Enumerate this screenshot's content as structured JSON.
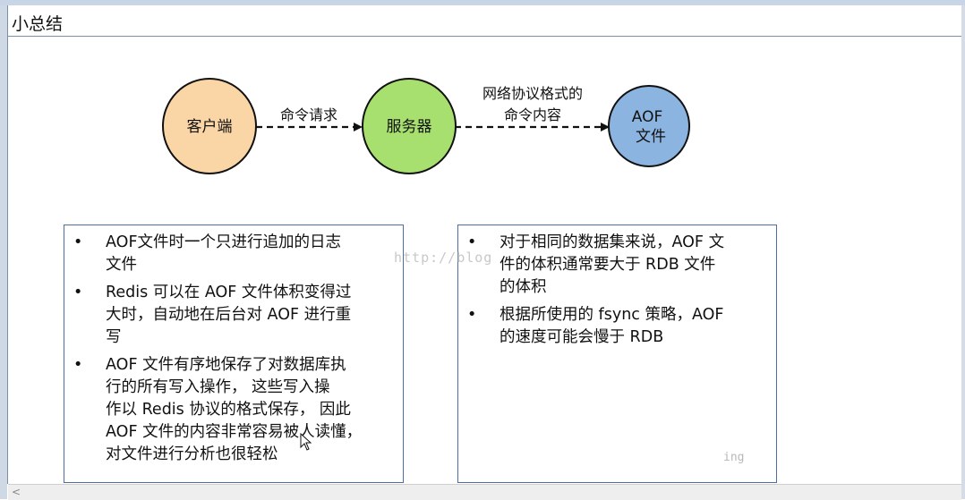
{
  "window": {
    "title": "小总结"
  },
  "diagram": {
    "nodes": [
      {
        "id": "client",
        "lines": [
          "客户端"
        ],
        "fill": "#fad5a5"
      },
      {
        "id": "server",
        "lines": [
          "服务器"
        ],
        "fill": "#a8e070"
      },
      {
        "id": "aof",
        "lines": [
          "AOF",
          "文件"
        ],
        "fill": "#8cb4e0"
      }
    ],
    "edges": [
      {
        "from": "client",
        "to": "server",
        "label_lines": [
          "命令请求"
        ]
      },
      {
        "from": "server",
        "to": "aof",
        "label_lines": [
          "网络协议格式的",
          "命令内容"
        ]
      }
    ],
    "stroke": "#111111"
  },
  "left_panel": {
    "bullet": "•",
    "items": [
      {
        "lines": [
          "AOF文件时一个只进行追加的日志",
          "文件"
        ]
      },
      {
        "lines": [
          "Redis 可以在 AOF 文件体积变得过",
          "大时，自动地在后台对 AOF 进行重",
          "写"
        ]
      },
      {
        "lines": [
          "AOF 文件有序地保存了对数据库执",
          "行的所有写入操作， 这些写入操",
          "作以 Redis 协议的格式保存， 因此",
          "AOF 文件的内容非常容易被人读懂，",
          "对文件进行分析也很轻松"
        ]
      }
    ]
  },
  "right_panel": {
    "bullet": "•",
    "items": [
      {
        "lines": [
          "对于相同的数据集来说，AOF 文",
          "件的体积通常要大于 RDB 文件",
          "的体积"
        ]
      },
      {
        "lines": [
          "根据所使用的 fsync 策略，AOF",
          "的速度可能会慢于 RDB"
        ]
      }
    ]
  },
  "watermark": {
    "url": "http://blog",
    "tail": "ing"
  },
  "scrollbar": {
    "left_arrow": "<"
  }
}
